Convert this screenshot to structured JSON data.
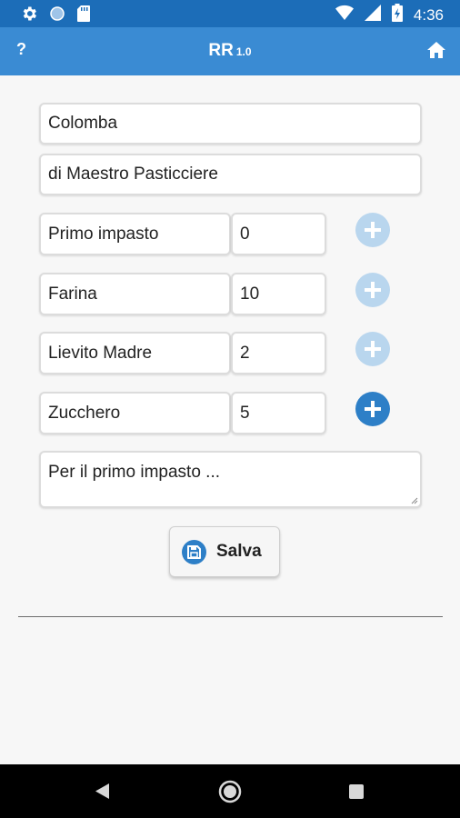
{
  "status_bar": {
    "time": "4:36",
    "icons": [
      "settings-icon",
      "circle-icon",
      "sd-card-icon",
      "wifi-icon",
      "signal-icon",
      "battery-charging-icon"
    ]
  },
  "app_bar": {
    "help_label": "?",
    "title": "RR",
    "version": "1.0",
    "home_icon": "home-icon"
  },
  "form": {
    "name": "Colomba",
    "subtitle": "di Maestro Pasticciere",
    "ingredients": [
      {
        "name": "Primo impasto",
        "qty": "0"
      },
      {
        "name": "Farina",
        "qty": "10"
      },
      {
        "name": "Lievito Madre",
        "qty": "2"
      },
      {
        "name": "Zucchero",
        "qty": "5"
      }
    ],
    "notes": "Per il primo impasto ..."
  },
  "save_button": {
    "label": "Salva",
    "icon": "floppy-disk-icon"
  },
  "colors": {
    "status_bar": "#1c6db8",
    "app_bar": "#3a8bd3",
    "plus_active": "#2d7fc7",
    "plus_dim": "#b9d6ee"
  }
}
